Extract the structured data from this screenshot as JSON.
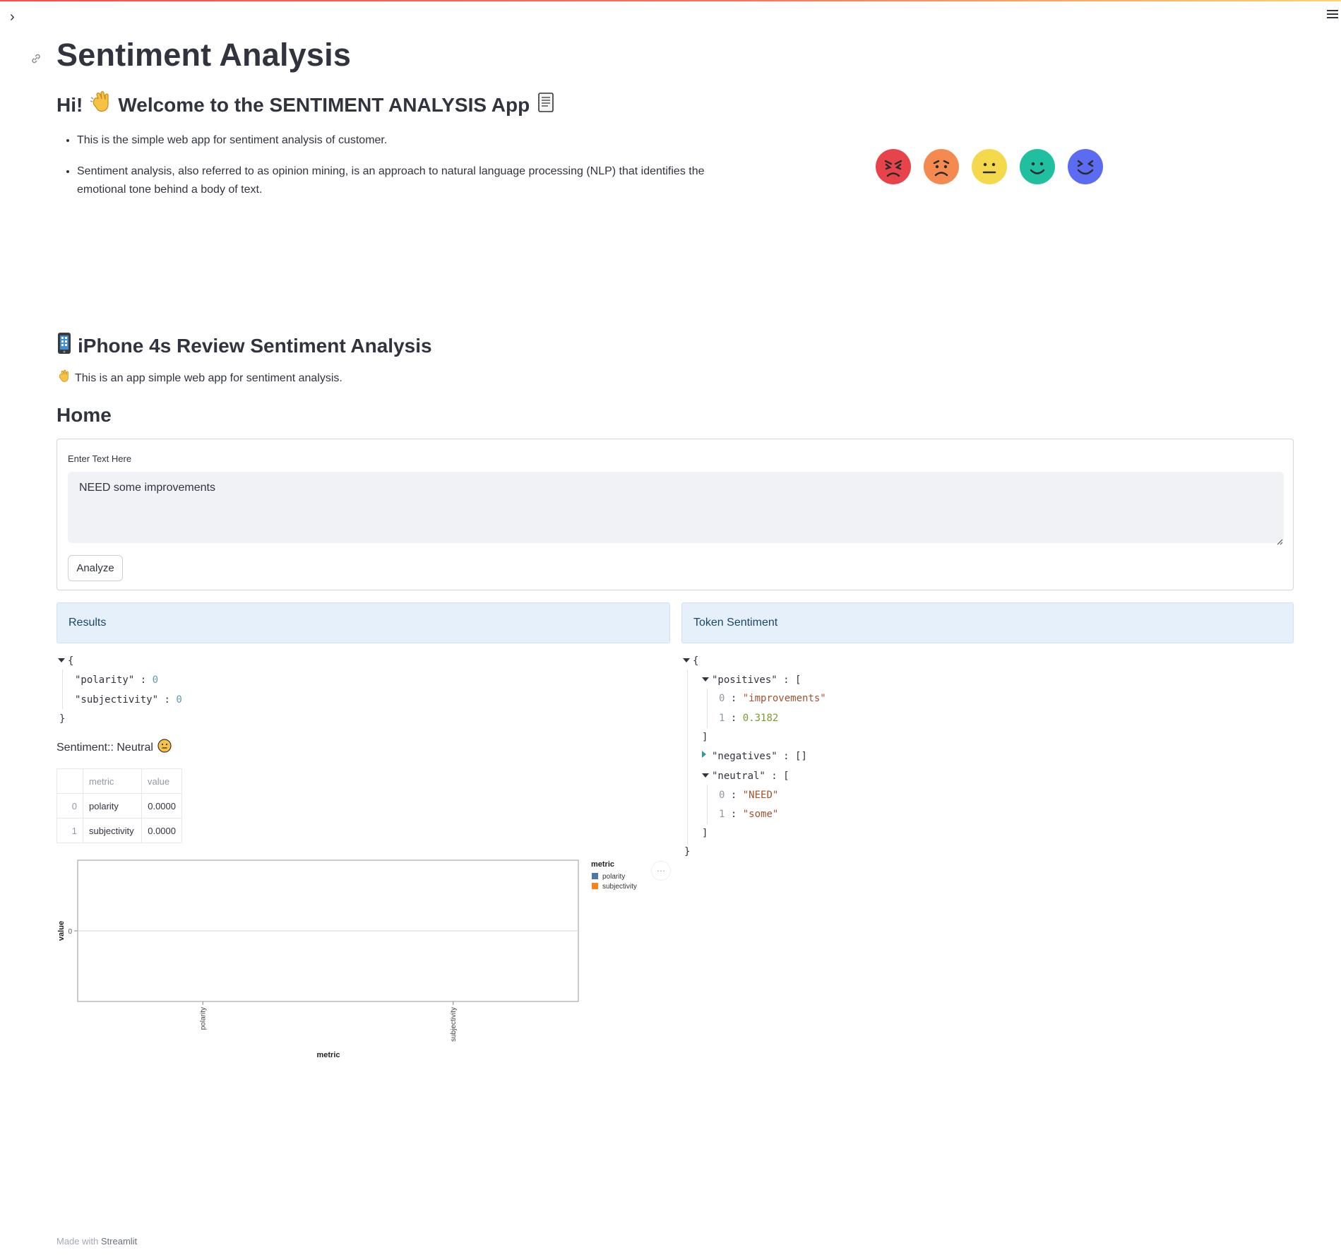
{
  "app": {
    "title": "Sentiment Analysis",
    "welcome_prefix": "Hi!",
    "welcome_text": "Welcome to the SENTIMENT ANALYSIS App",
    "bullets": [
      "This is the simple web app for sentiment analysis of customer.",
      "Sentiment analysis, also referred to as opinion mining, is an approach to natural language processing (NLP) that identifies the emotional tone behind a body of text."
    ],
    "sentiment_faces": [
      "angry",
      "sad",
      "neutral",
      "happy",
      "very-happy"
    ],
    "face_colors": [
      "#e8434a",
      "#f48a4f",
      "#f4d94c",
      "#1fbf9f",
      "#5b6bf2"
    ]
  },
  "section": {
    "title": "iPhone 4s Review Sentiment Analysis",
    "intro": "This is an app simple web app for sentiment analysis.",
    "home_heading": "Home"
  },
  "form": {
    "label": "Enter Text Here",
    "text_value": "NEED some improvements",
    "analyze_label": "Analyze"
  },
  "results": {
    "heading": "Results",
    "json": {
      "polarity": 0,
      "subjectivity": 0
    },
    "sentiment_prefix": "Sentiment:: Neutral",
    "table": {
      "columns": [
        "",
        "metric",
        "value"
      ],
      "rows": [
        [
          "0",
          "polarity",
          "0.0000"
        ],
        [
          "1",
          "subjectivity",
          "0.0000"
        ]
      ]
    }
  },
  "token_sentiment": {
    "heading": "Token Sentiment",
    "positives_key": "\"positives\"",
    "positives": [
      "\"improvements\"",
      "0.3182"
    ],
    "negatives_key": "\"negatives\"",
    "negatives_value": "[]",
    "neutral_key": "\"neutral\"",
    "neutral": [
      "\"NEED\"",
      "\"some\""
    ]
  },
  "chart_data": {
    "type": "bar",
    "categories": [
      "polarity",
      "subjectivity"
    ],
    "values": [
      0,
      0
    ],
    "xlabel": "metric",
    "ylabel": "value",
    "y_ticks": [
      "0"
    ],
    "legend_title": "metric",
    "legend": [
      "polarity",
      "subjectivity"
    ],
    "colors": [
      "#4c78a8",
      "#f58518"
    ],
    "legend_position": "right"
  },
  "footer": {
    "made_with": "Made with",
    "brand": "Streamlit"
  }
}
